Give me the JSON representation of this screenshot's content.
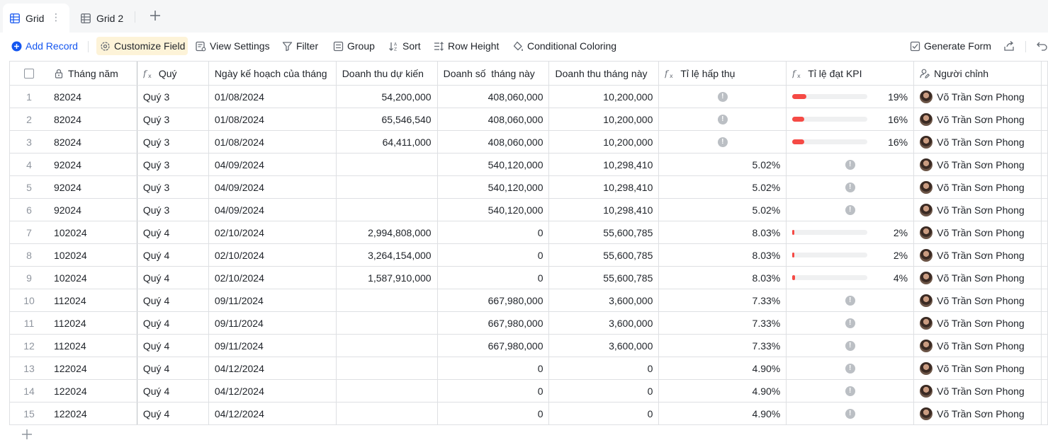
{
  "tabs": [
    {
      "label": "Grid",
      "active": true
    },
    {
      "label": "Grid 2",
      "active": false
    }
  ],
  "toolbar": {
    "add_record": "Add Record",
    "customize_field": "Customize Field",
    "view_settings": "View Settings",
    "filter": "Filter",
    "group": "Group",
    "sort": "Sort",
    "row_height": "Row Height",
    "conditional_coloring": "Conditional Coloring",
    "generate_form": "Generate Form"
  },
  "columns": {
    "thang_nam": "Tháng năm",
    "quy": "Quý",
    "ngay": "Ngày kế hoạch của tháng",
    "dtdk": "Doanh thu dự kiến",
    "ds": "Doanh số  tháng này",
    "dt": "Doanh thu tháng này",
    "hap": "Tỉ lệ hấp thụ",
    "kpi": "Tỉ lệ đạt KPI",
    "nguoi": "Người chỉnh"
  },
  "colors": {
    "accent": "#1456f0",
    "kpi_bar": "#f54a45",
    "highlight": "#fdf3d8"
  },
  "rows": [
    {
      "idx": "1",
      "thang_nam": "82024",
      "quy": "Quý 3",
      "ngay": "01/08/2024",
      "dtdk": "54,200,000",
      "ds": "408,060,000",
      "dt": "10,200,000",
      "hap": null,
      "kpi": 0.19,
      "kpi_label": "19%",
      "nguoi": "Võ Trần Sơn Phong"
    },
    {
      "idx": "2",
      "thang_nam": "82024",
      "quy": "Quý 3",
      "ngay": "01/08/2024",
      "dtdk": "65,546,540",
      "ds": "408,060,000",
      "dt": "10,200,000",
      "hap": null,
      "kpi": 0.16,
      "kpi_label": "16%",
      "nguoi": "Võ Trần Sơn Phong"
    },
    {
      "idx": "3",
      "thang_nam": "82024",
      "quy": "Quý 3",
      "ngay": "01/08/2024",
      "dtdk": "64,411,000",
      "ds": "408,060,000",
      "dt": "10,200,000",
      "hap": null,
      "kpi": 0.16,
      "kpi_label": "16%",
      "nguoi": "Võ Trần Sơn Phong"
    },
    {
      "idx": "4",
      "thang_nam": "92024",
      "quy": "Quý 3",
      "ngay": "04/09/2024",
      "dtdk": "",
      "ds": "540,120,000",
      "dt": "10,298,410",
      "hap": "5.02%",
      "kpi": null,
      "kpi_label": "",
      "nguoi": "Võ Trần Sơn Phong"
    },
    {
      "idx": "5",
      "thang_nam": "92024",
      "quy": "Quý 3",
      "ngay": "04/09/2024",
      "dtdk": "",
      "ds": "540,120,000",
      "dt": "10,298,410",
      "hap": "5.02%",
      "kpi": null,
      "kpi_label": "",
      "nguoi": "Võ Trần Sơn Phong"
    },
    {
      "idx": "6",
      "thang_nam": "92024",
      "quy": "Quý 3",
      "ngay": "04/09/2024",
      "dtdk": "",
      "ds": "540,120,000",
      "dt": "10,298,410",
      "hap": "5.02%",
      "kpi": null,
      "kpi_label": "",
      "nguoi": "Võ Trần Sơn Phong"
    },
    {
      "idx": "7",
      "thang_nam": "102024",
      "quy": "Quý 4",
      "ngay": "02/10/2024",
      "dtdk": "2,994,808,000",
      "ds": "0",
      "dt": "55,600,785",
      "hap": "8.03%",
      "kpi": 0.02,
      "kpi_label": "2%",
      "nguoi": "Võ Trần Sơn Phong"
    },
    {
      "idx": "8",
      "thang_nam": "102024",
      "quy": "Quý 4",
      "ngay": "02/10/2024",
      "dtdk": "3,264,154,000",
      "ds": "0",
      "dt": "55,600,785",
      "hap": "8.03%",
      "kpi": 0.02,
      "kpi_label": "2%",
      "nguoi": "Võ Trần Sơn Phong"
    },
    {
      "idx": "9",
      "thang_nam": "102024",
      "quy": "Quý 4",
      "ngay": "02/10/2024",
      "dtdk": "1,587,910,000",
      "ds": "0",
      "dt": "55,600,785",
      "hap": "8.03%",
      "kpi": 0.04,
      "kpi_label": "4%",
      "nguoi": "Võ Trần Sơn Phong"
    },
    {
      "idx": "10",
      "thang_nam": "112024",
      "quy": "Quý 4",
      "ngay": "09/11/2024",
      "dtdk": "",
      "ds": "667,980,000",
      "dt": "3,600,000",
      "hap": "7.33%",
      "kpi": null,
      "kpi_label": "",
      "nguoi": "Võ Trần Sơn Phong"
    },
    {
      "idx": "11",
      "thang_nam": "112024",
      "quy": "Quý 4",
      "ngay": "09/11/2024",
      "dtdk": "",
      "ds": "667,980,000",
      "dt": "3,600,000",
      "hap": "7.33%",
      "kpi": null,
      "kpi_label": "",
      "nguoi": "Võ Trần Sơn Phong"
    },
    {
      "idx": "12",
      "thang_nam": "112024",
      "quy": "Quý 4",
      "ngay": "09/11/2024",
      "dtdk": "",
      "ds": "667,980,000",
      "dt": "3,600,000",
      "hap": "7.33%",
      "kpi": null,
      "kpi_label": "",
      "nguoi": "Võ Trần Sơn Phong"
    },
    {
      "idx": "13",
      "thang_nam": "122024",
      "quy": "Quý 4",
      "ngay": "04/12/2024",
      "dtdk": "",
      "ds": "0",
      "dt": "0",
      "hap": "4.90%",
      "kpi": null,
      "kpi_label": "",
      "nguoi": "Võ Trần Sơn Phong"
    },
    {
      "idx": "14",
      "thang_nam": "122024",
      "quy": "Quý 4",
      "ngay": "04/12/2024",
      "dtdk": "",
      "ds": "0",
      "dt": "0",
      "hap": "4.90%",
      "kpi": null,
      "kpi_label": "",
      "nguoi": "Võ Trần Sơn Phong"
    },
    {
      "idx": "15",
      "thang_nam": "122024",
      "quy": "Quý 4",
      "ngay": "04/12/2024",
      "dtdk": "",
      "ds": "0",
      "dt": "0",
      "hap": "4.90%",
      "kpi": null,
      "kpi_label": "",
      "nguoi": "Võ Trần Sơn Phong"
    }
  ]
}
